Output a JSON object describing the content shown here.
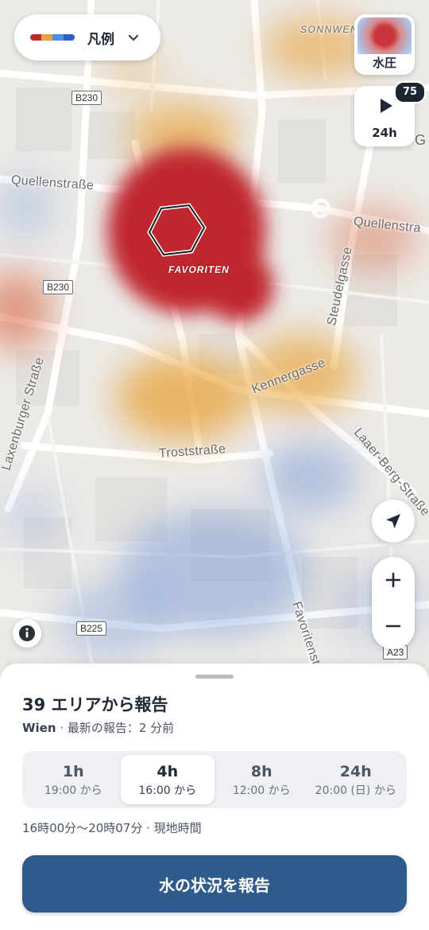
{
  "map": {
    "streets": {
      "quellen_left": "Quellenstraße",
      "quellen_right": "Quellenstra",
      "laxenburger": "Laxenburger Straße",
      "steudel": "Steudelgasse",
      "kenner": "Kennergasse",
      "troststrasse": "Troststraße",
      "laaer_berg": "Laaer-Berg-Straße",
      "favoritenstr": "Favoritenst",
      "sonnwend": "SONNWEN",
      "partial_g": "G"
    },
    "route_shields": {
      "b230_top": "B230",
      "b230_mid": "B230",
      "b225": "B225",
      "a23": "A23"
    },
    "district_label": "FAVORITEN",
    "heat_colors": {
      "high": "#c0282e",
      "medium": "#e8a33a",
      "low": "#6f93d6"
    }
  },
  "legend": {
    "label": "凡例",
    "swatch_colors": [
      "#c0282e",
      "#e8a33a",
      "#4f8de8",
      "#2c5fc5"
    ]
  },
  "layer": {
    "label": "水圧"
  },
  "playback": {
    "label": "24h",
    "badge": "75"
  },
  "sheet": {
    "title": "39 エリアから報告",
    "city": "Wien",
    "latest": " · 最新の報告：2 分前",
    "time_options": [
      {
        "label": "1h",
        "sub": "19:00 から"
      },
      {
        "label": "4h",
        "sub": "16:00 から"
      },
      {
        "label": "8h",
        "sub": "12:00 から"
      },
      {
        "label": "24h",
        "sub": "20:00 (日) から"
      }
    ],
    "selected_time_option": "4h",
    "range_note": "16時00分～20時07分 · 現地時間",
    "report_button": "水の状況を報告"
  }
}
